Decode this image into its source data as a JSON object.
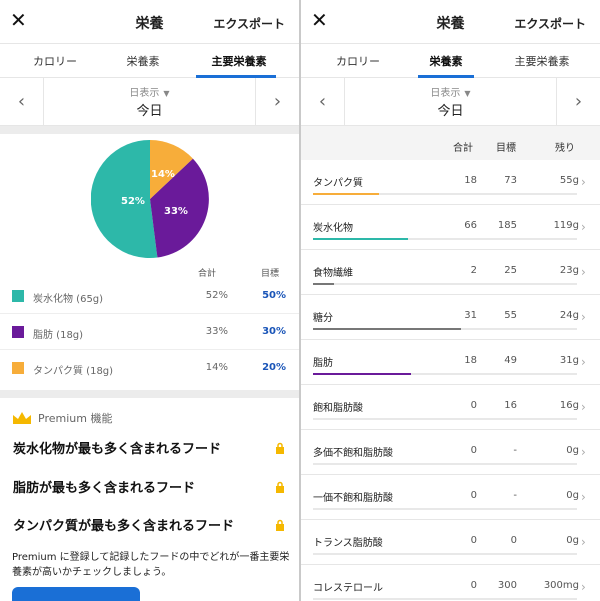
{
  "left": {
    "title": "栄養",
    "export_label": "エクスポート",
    "tabs": [
      {
        "label": "カロリー",
        "active": false
      },
      {
        "label": "栄養素",
        "active": false
      },
      {
        "label": "主要栄養素",
        "active": true
      }
    ],
    "day_view_label": "日表示",
    "day_label": "今日",
    "pie_labels": [
      "52%",
      "33%",
      "14%"
    ],
    "legend_headers": {
      "total": "合計",
      "goal": "目標"
    },
    "macros": [
      {
        "name": "炭水化物 (65g)",
        "percent": "52%",
        "goal": "50%",
        "color": "#2db8a9"
      },
      {
        "name": "脂肪 (18g)",
        "percent": "33%",
        "goal": "30%",
        "color": "#6a1a9a"
      },
      {
        "name": "タンパク質 (18g)",
        "percent": "14%",
        "goal": "20%",
        "color": "#f7ad3a"
      }
    ],
    "premium_label": "Premium 機能",
    "premium_features": [
      "炭水化物が最も多く含まれるフード",
      "脂肪が最も多く含まれるフード",
      "タンパク質が最も多く含まれるフード"
    ],
    "promo_text": "Premium に登録して記録したフードの中でどれが一番主要栄養素が高いかチェックしましょう。"
  },
  "right": {
    "title": "栄養",
    "export_label": "エクスポート",
    "tabs": [
      {
        "label": "カロリー",
        "active": false
      },
      {
        "label": "栄養素",
        "active": true
      },
      {
        "label": "主要栄養素",
        "active": false
      }
    ],
    "day_view_label": "日表示",
    "day_label": "今日",
    "headers": {
      "total": "合計",
      "goal": "目標",
      "remaining": "残り"
    },
    "nutrients": [
      {
        "name": "タンパク質",
        "total": "18",
        "goal": "73",
        "remaining": "55g",
        "progress": 0.25,
        "color": "#f7ad3a"
      },
      {
        "name": "炭水化物",
        "total": "66",
        "goal": "185",
        "remaining": "119g",
        "progress": 0.36,
        "color": "#2db8a9"
      },
      {
        "name": "食物繊維",
        "total": "2",
        "goal": "25",
        "remaining": "23g",
        "progress": 0.08,
        "color": "#777777"
      },
      {
        "name": "糖分",
        "total": "31",
        "goal": "55",
        "remaining": "24g",
        "progress": 0.56,
        "color": "#777777"
      },
      {
        "name": "脂肪",
        "total": "18",
        "goal": "49",
        "remaining": "31g",
        "progress": 0.37,
        "color": "#6a1a9a"
      },
      {
        "name": "飽和脂肪酸",
        "total": "0",
        "goal": "16",
        "remaining": "16g",
        "progress": 0,
        "color": "#777777"
      },
      {
        "name": "多価不飽和脂肪酸",
        "total": "0",
        "goal": "-",
        "remaining": "0g",
        "progress": 0,
        "color": "#777777"
      },
      {
        "name": "一価不飽和脂肪酸",
        "total": "0",
        "goal": "-",
        "remaining": "0g",
        "progress": 0,
        "color": "#777777"
      },
      {
        "name": "トランス脂肪酸",
        "total": "0",
        "goal": "0",
        "remaining": "0g",
        "progress": 0,
        "color": "#777777"
      },
      {
        "name": "コレステロール",
        "total": "0",
        "goal": "300",
        "remaining": "300mg",
        "progress": 0,
        "color": "#777777"
      }
    ]
  }
}
